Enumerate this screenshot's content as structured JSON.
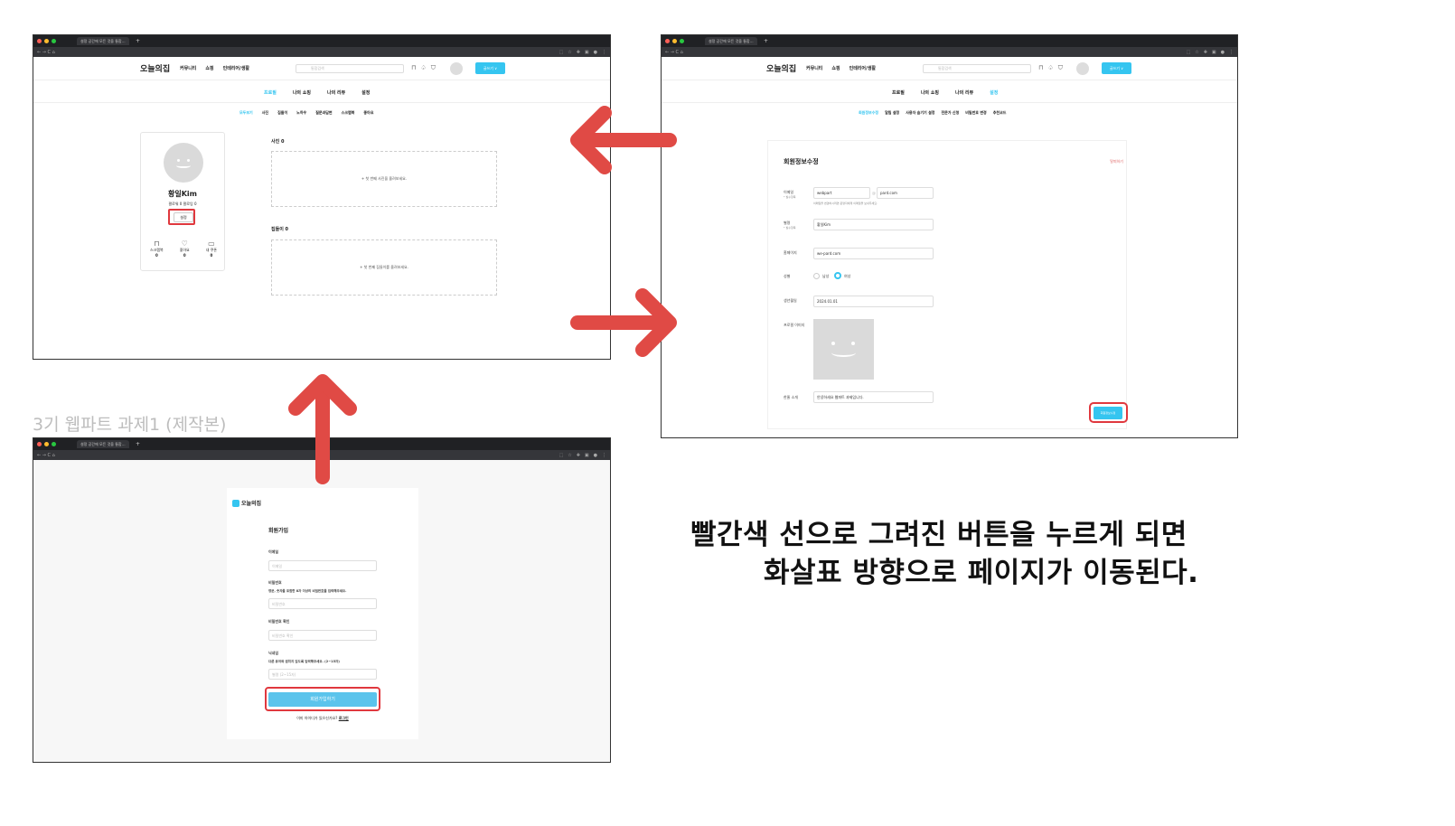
{
  "browser": {
    "tab_title": "설정 공간에 모든 것을 통합…",
    "tab_plus": "+",
    "nav_glyphs": "← → C ⌂"
  },
  "site": {
    "logo": "오늘의집",
    "nav": [
      "커뮤니티",
      "쇼핑",
      "인테리어/생활"
    ],
    "search_placeholder": "통합검색",
    "write_button": "글쓰기 ∨"
  },
  "profile_window": {
    "subnav": [
      "프로필",
      "나의 쇼핑",
      "나의 리뷰",
      "설정"
    ],
    "subnav_active": 0,
    "subnav2": [
      "모두보기",
      "사진",
      "집들이",
      "노하우",
      "질문과답변",
      "스크랩북",
      "좋아요"
    ],
    "user_name": "황일Kim",
    "follow": "팔로워 0  팔로잉 0",
    "settings_button": "설정",
    "stats": [
      {
        "icon": "bookmark-icon",
        "label": "스크랩북",
        "value": "0"
      },
      {
        "icon": "heart-icon",
        "label": "좋아요",
        "value": "0"
      },
      {
        "icon": "coupon-icon",
        "label": "내 쿠폰",
        "value": "0"
      }
    ],
    "photo_title": "사진 0",
    "photo_empty": "+ 첫 번째 사진을 올려보세요.",
    "house_title": "집들이 0",
    "house_empty": "+ 첫 번째 집들이를 올려보세요."
  },
  "settings_window": {
    "subnav": [
      "프로필",
      "나의 쇼핑",
      "나의 리뷰",
      "설정"
    ],
    "subnav_active": 3,
    "subnav2": [
      "회원정보수정",
      "알림 설정",
      "사용자 숨기기 설정",
      "전문가 신청",
      "비밀번호 변경",
      "추천코드"
    ],
    "form_title": "회원정보수정",
    "withdraw": "탈퇴하기",
    "email_label": "이메일",
    "email_required": "* 필수항목",
    "email_id": "webpart",
    "email_at": "@",
    "email_domain": "pard.com",
    "email_hint": "이메일을 변경하시려면 운영자에게 이메일을 보내주세요.",
    "nick_label": "별명",
    "nick_required": "* 필수항목",
    "nick_value": "황일Kim",
    "homepage_label": "홈페이지",
    "homepage_value": "we-pard.com",
    "gender_label": "성별",
    "gender_male": "남성",
    "gender_female": "여성",
    "birth_label": "생년월일",
    "birth_value": "2024.01.01",
    "image_label": "프로필 이미지",
    "intro_label": "한줄 소개",
    "intro_value": "안녕하세요 웹파트 과제입니다.",
    "submit_button": "회원정보수정"
  },
  "signup_window": {
    "logo": "오늘의집",
    "title": "회원가입",
    "email_label": "이메일",
    "email_placeholder": "이메일",
    "pw_label": "비밀번호",
    "pw_hint": "영문, 숫자를 포함한 8자 이상의 비밀번호를 입력해주세요.",
    "pw_placeholder": "비밀번호",
    "pw2_label": "비밀번호 확인",
    "pw2_placeholder": "비밀번호 확인",
    "nick_label": "닉네임",
    "nick_hint": "다른 유저와 겹치지 않도록 입력해주세요. (2~15자)",
    "nick_placeholder": "별명 (2~15자)",
    "submit_button": "회원가입하기",
    "login_prompt": "이미 아이디가 있으신가요?",
    "login_link": "로그인"
  },
  "side_title": "3기 웹파트 과제1 (제작본)",
  "caption_line1": "빨간색 선으로 그려진 버튼을 누르게 되면",
  "caption_line2": "화살표 방향으로 페이지가 이동된다.",
  "colors": {
    "accent": "#35c5f0",
    "arrow": "#e04a45",
    "highlight": "#e0383e"
  }
}
